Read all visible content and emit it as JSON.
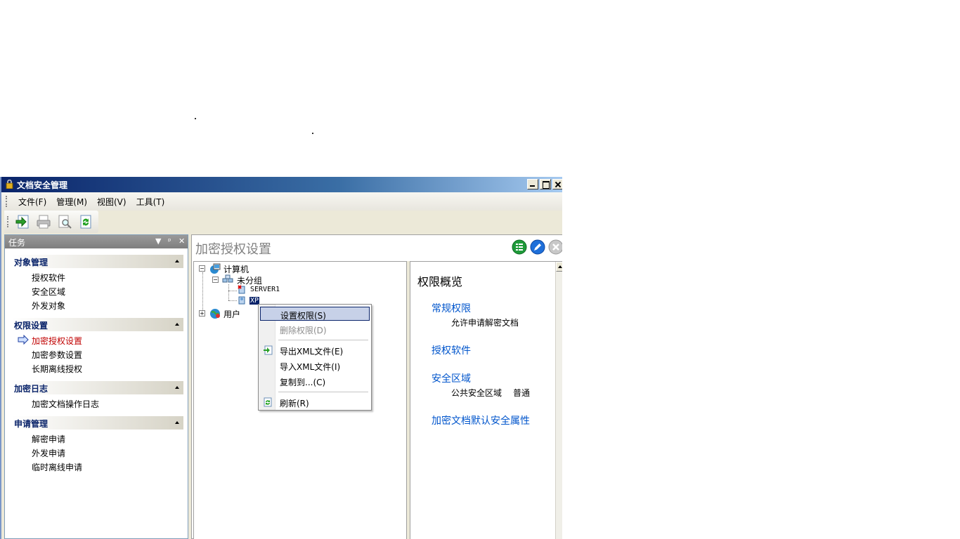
{
  "window": {
    "title": "文档安全管理"
  },
  "menubar": {
    "items": [
      "文件(F)",
      "管理(M)",
      "视图(V)",
      "工具(T)"
    ]
  },
  "toolbar": {
    "buttons": [
      "export-icon",
      "print-icon",
      "preview-icon",
      "refresh-icon"
    ]
  },
  "taskpane": {
    "title": "任务",
    "sections": [
      {
        "title": "对象管理",
        "items": [
          "授权软件",
          "安全区域",
          "外发对象"
        ]
      },
      {
        "title": "权限设置",
        "items": [
          "加密授权设置",
          "加密参数设置",
          "长期离线授权"
        ]
      },
      {
        "title": "加密日志",
        "items": [
          "加密文档操作日志"
        ]
      },
      {
        "title": "申请管理",
        "items": [
          "解密申请",
          "外发申请",
          "临时离线申请"
        ]
      }
    ],
    "active_item": "加密授权设置"
  },
  "content": {
    "title": "加密授权设置",
    "tree": {
      "root": "计算机",
      "group": "未分组",
      "nodes": [
        "SERVER1",
        "XP"
      ],
      "users": "用户"
    },
    "overview": {
      "title": "权限概览",
      "general_link": "常规权限",
      "general_text": "允许申请解密文档",
      "software_link": "授权软件",
      "zone_link": "安全区域",
      "zone_name": "公共安全区域",
      "zone_level": "普通",
      "default_link": "加密文档默认安全属性"
    }
  },
  "context_menu": {
    "items": [
      {
        "label": "设置权限(S)",
        "state": "highlighted"
      },
      {
        "label": "删除权限(D)",
        "state": "disabled"
      },
      {
        "label": "导出XML文件(E)",
        "state": "normal"
      },
      {
        "label": "导入XML文件(I)",
        "state": "normal"
      },
      {
        "label": "复制到...(C)",
        "state": "normal"
      },
      {
        "label": "刷新(R)",
        "state": "normal"
      }
    ]
  }
}
